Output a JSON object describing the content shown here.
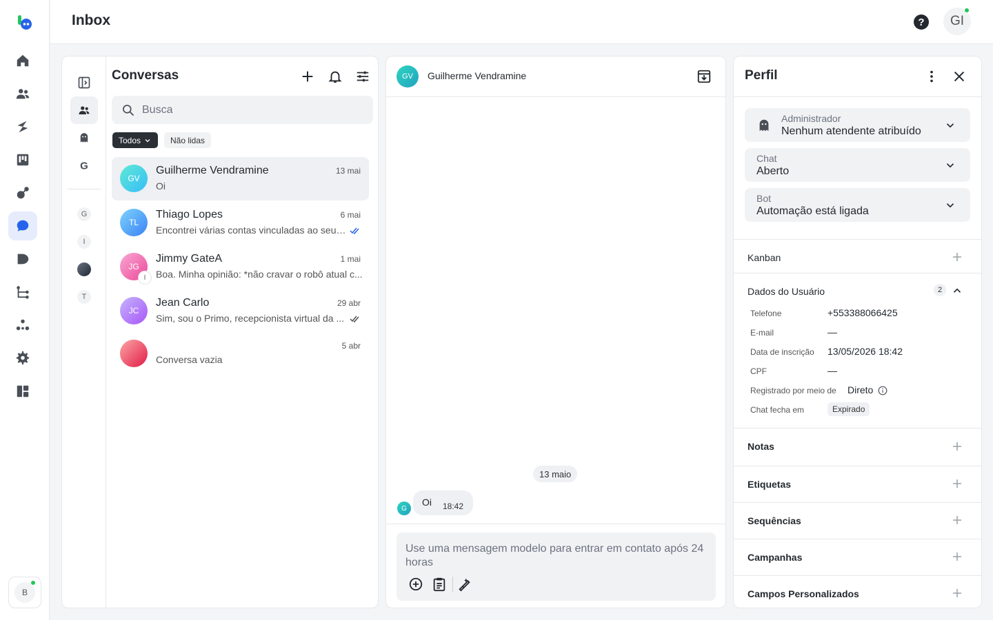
{
  "header": {
    "title": "Inbox",
    "user_initials": "GI"
  },
  "rail": {
    "items": [
      "home-icon",
      "contacts-icon",
      "zap-icon",
      "kanban-icon",
      "broadcast-icon",
      "chat-icon",
      "play-icon",
      "flow-icon",
      "integrations-icon",
      "settings-icon",
      "dashboard-icon"
    ],
    "active": "chat-icon",
    "bot_initial": "B"
  },
  "conversations": {
    "title": "Conversas",
    "search_placeholder": "Busca",
    "filters": {
      "all": "Todos",
      "unread": "Não lidas"
    },
    "subrail": {
      "letters": [
        "G",
        "I",
        "T"
      ]
    },
    "items": [
      {
        "initials": "GV",
        "name": "Guilherme Vendramine",
        "date": "13 mai",
        "preview": "Oi",
        "color_from": "#5eead4",
        "color_to": "#38bdf8"
      },
      {
        "initials": "TL",
        "name": "Thiago Lopes",
        "date": "6 mai",
        "preview": "Encontrei várias contas vinculadas ao seu ...",
        "color_from": "#7dd3fc",
        "color_to": "#3b82f6"
      },
      {
        "initials": "JG",
        "name": "Jimmy GateA",
        "date": "1 mai",
        "preview": "Boa. Minha opinião: *não cravar o robô atual c...",
        "mini": "I",
        "color_from": "#f9a8d4",
        "color_to": "#ec4899"
      },
      {
        "initials": "JC",
        "name": "Jean Carlo",
        "date": "29 abr",
        "preview": "Sim, sou o Primo, recepcionista virtual da ...",
        "color_from": "#c4b5fd",
        "color_to": "#a855f7"
      },
      {
        "initials": "",
        "name": "",
        "date": "5 abr",
        "preview": "Conversa vazia",
        "color_from": "#fca5a5",
        "color_to": "#e11d48"
      }
    ]
  },
  "chat": {
    "contact_initials": "GV",
    "contact_name": "Guilherme Vendramine",
    "date_divider": "13 maio",
    "messages": [
      {
        "sender_initial": "G",
        "text": "Oi",
        "time": "18:42"
      }
    ],
    "composer_placeholder": "Use uma mensagem modelo para entrar em contato após 24 horas"
  },
  "profile": {
    "title": "Perfil",
    "selects": [
      {
        "label": "Administrador",
        "value": "Nenhum atendente atribuído"
      },
      {
        "label": "Chat",
        "value": "Aberto"
      },
      {
        "label": "Bot",
        "value": "Automação está ligada"
      }
    ],
    "sections": {
      "kanban": "Kanban",
      "user_data": "Dados do Usuário",
      "user_data_count": "2",
      "notes": "Notas",
      "tags": "Etiquetas",
      "sequences": "Sequências",
      "campaigns": "Campanhas",
      "custom_fields": "Campos Personalizados"
    },
    "fields": [
      {
        "label": "Telefone",
        "value": "+553388066425"
      },
      {
        "label": "E-mail",
        "value": "—"
      },
      {
        "label": "Data de inscrição",
        "value": "13/05/2026 18:42"
      },
      {
        "label": "CPF",
        "value": "—"
      },
      {
        "label": "Registrado por meio de",
        "value": "Direto"
      },
      {
        "label": "Chat fecha em",
        "value": "Expirado"
      }
    ]
  },
  "colors": {
    "accent": "#2563eb",
    "online": "#22c55e",
    "active_bg": "#e6ecfb"
  }
}
